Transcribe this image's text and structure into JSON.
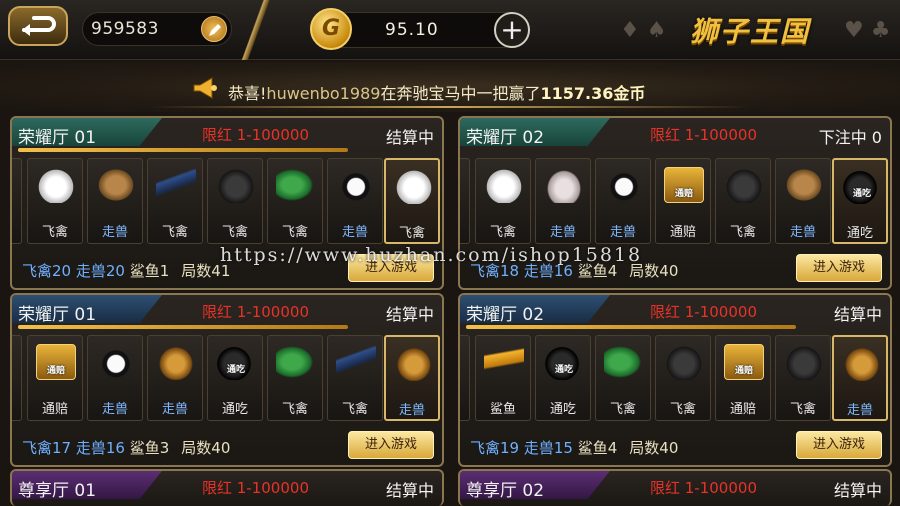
{
  "header": {
    "account_id": "959583",
    "coins": "95.10",
    "title": "狮子王国",
    "suits_left": "♦ ♠",
    "suits_right": "♥ ♣"
  },
  "announcement": {
    "prefix": "恭喜!",
    "user": "huwenbo1989",
    "middle": "在奔驰宝马中一把赢了",
    "amount": "1157.36金币"
  },
  "enter_label": "进入游戏",
  "panels": [
    {
      "room": "荣耀厅 01",
      "limit": "限红 1-100000",
      "status": "结算中",
      "cards": [
        {
          "icon": "dove",
          "label": "飞禽"
        },
        {
          "icon": "monkey",
          "label": "走兽"
        },
        {
          "icon": "swallow",
          "label": "飞禽"
        },
        {
          "icon": "eagle",
          "label": "飞禽"
        },
        {
          "icon": "peacock",
          "label": "飞禽"
        },
        {
          "icon": "panda",
          "label": "走兽"
        },
        {
          "icon": "dove",
          "label": "飞禽"
        }
      ],
      "fly": "飞禽20",
      "beast": "走兽20",
      "shark": "鲨鱼1",
      "rounds": "局数41"
    },
    {
      "room": "荣耀厅 02",
      "limit": "限红 1-100000",
      "status": "下注中 0",
      "cards": [
        {
          "icon": "dove",
          "label": "飞禽"
        },
        {
          "icon": "rabbit",
          "label": "走兽"
        },
        {
          "icon": "panda",
          "label": "走兽"
        },
        {
          "icon": "chest",
          "label": "通赔",
          "tag": "通赔"
        },
        {
          "icon": "eagle",
          "label": "飞禽"
        },
        {
          "icon": "monkey",
          "label": "走兽"
        },
        {
          "icon": "bomb",
          "label": "通吃",
          "tag": "通吃"
        }
      ],
      "fly": "飞禽18",
      "beast": "走兽16",
      "shark": "鲨鱼4",
      "rounds": "局数40"
    },
    {
      "room": "荣耀厅 01",
      "limit": "限红 1-100000",
      "status": "结算中",
      "cards": [
        {
          "icon": "chest",
          "label": "通赔",
          "tag": "通赔"
        },
        {
          "icon": "panda",
          "label": "走兽"
        },
        {
          "icon": "lion",
          "label": "走兽"
        },
        {
          "icon": "bomb",
          "label": "通吃",
          "tag": "通吃"
        },
        {
          "icon": "peacock",
          "label": "飞禽"
        },
        {
          "icon": "swallow",
          "label": "飞禽"
        },
        {
          "icon": "lion",
          "label": "走兽"
        }
      ],
      "fly": "飞禽17",
      "beast": "走兽16",
      "shark": "鲨鱼3",
      "rounds": "局数40"
    },
    {
      "room": "荣耀厅 02",
      "limit": "限红 1-100000",
      "status": "结算中",
      "cards": [
        {
          "icon": "shark",
          "label": "鲨鱼"
        },
        {
          "icon": "bomb",
          "label": "通吃",
          "tag": "通吃"
        },
        {
          "icon": "peacock",
          "label": "飞禽"
        },
        {
          "icon": "eagle",
          "label": "飞禽"
        },
        {
          "icon": "chest",
          "label": "通赔",
          "tag": "通赔"
        },
        {
          "icon": "eagle",
          "label": "飞禽"
        },
        {
          "icon": "lion",
          "label": "走兽"
        }
      ],
      "fly": "飞禽19",
      "beast": "走兽15",
      "shark": "鲨鱼4",
      "rounds": "局数40"
    },
    {
      "room": "尊享厅 01",
      "limit": "限红 1-100000",
      "status": "结算中"
    },
    {
      "room": "尊享厅 02",
      "limit": "限红 1-100000",
      "status": "结算中"
    }
  ],
  "watermark": "https://www.huzhan.com/ishop15818"
}
